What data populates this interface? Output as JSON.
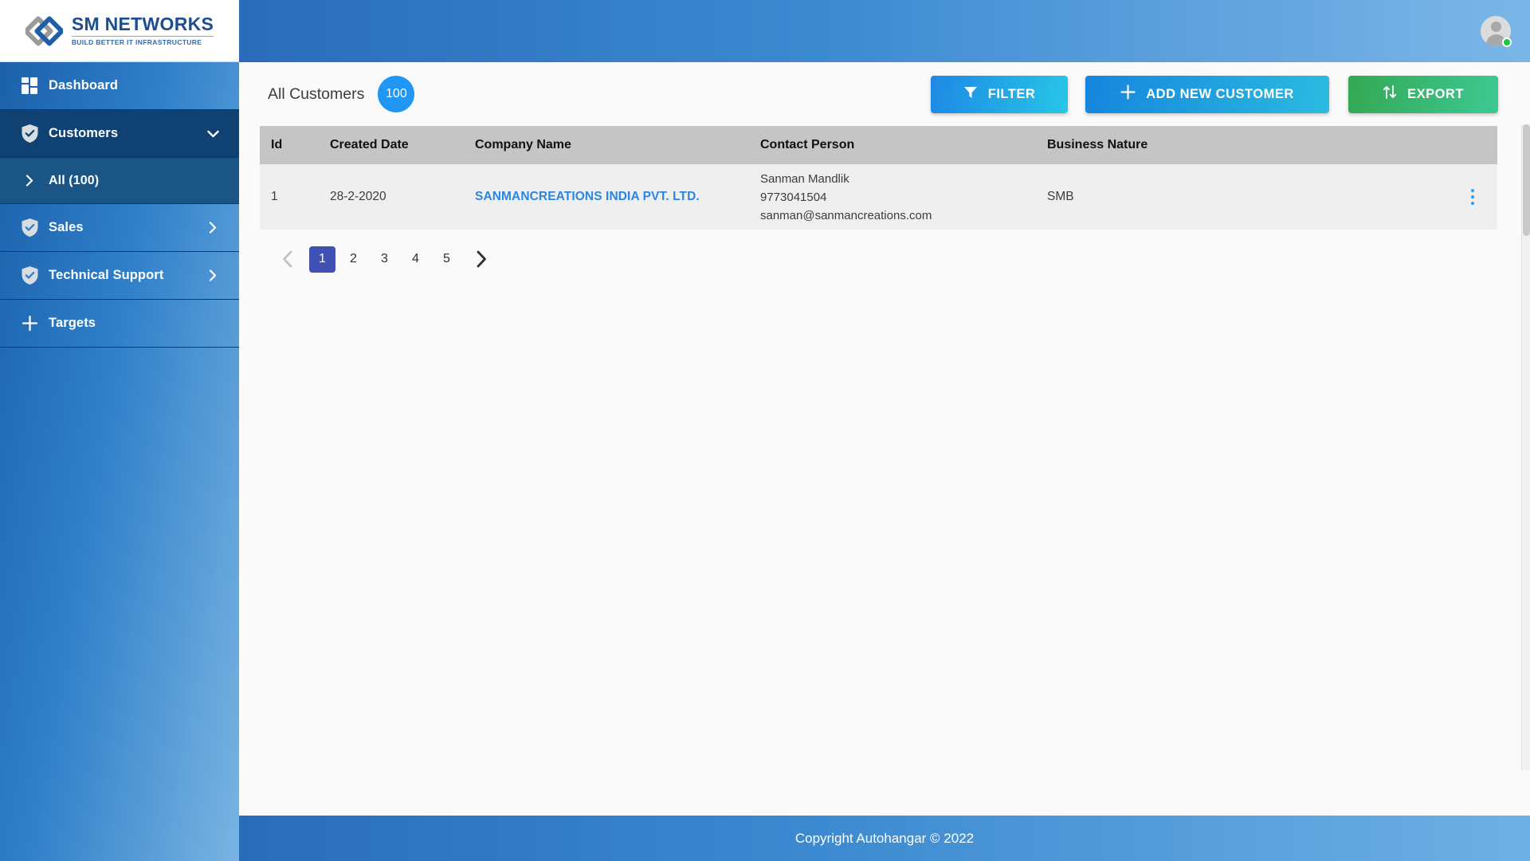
{
  "brand": {
    "name": "SM NETWORKS",
    "tagline": "BUILD BETTER IT INFRASTRUCTURE",
    "logo_icon": "interlocking-squares-logo",
    "color_primary": "#1d4e8f",
    "color_accent": "#2d6bb5"
  },
  "sidebar": {
    "items": [
      {
        "label": "Dashboard",
        "icon": "grid-dashboard-icon",
        "chevron": "",
        "state": "default"
      },
      {
        "label": "Customers",
        "icon": "shield-check-icon",
        "chevron": "down",
        "state": "active"
      },
      {
        "label": "All (100)",
        "icon": "chevron-right-icon",
        "chevron": "",
        "state": "sub-active"
      },
      {
        "label": "Sales",
        "icon": "shield-check-icon",
        "chevron": "right",
        "state": "default"
      },
      {
        "label": "Technical Support",
        "icon": "shield-check-icon",
        "chevron": "right",
        "state": "default"
      },
      {
        "label": "Targets",
        "icon": "plus-icon",
        "chevron": "",
        "state": "default"
      }
    ]
  },
  "topbar": {
    "avatar_icon": "user-avatar-icon",
    "status": "online",
    "status_color": "#12cc3d"
  },
  "main": {
    "page_title": "All Customers",
    "count_badge": "100",
    "badge_color": "#2196f3",
    "buttons": {
      "filter": {
        "label": "FILTER",
        "icon": "funnel-icon"
      },
      "add": {
        "label": "ADD NEW CUSTOMER",
        "icon": "plus-icon"
      },
      "export": {
        "label": "EXPORT",
        "icon": "sort-updown-arrows-icon"
      }
    },
    "table": {
      "columns": [
        "Id",
        "Created Date",
        "Company Name",
        "Contact Person",
        "Business Nature"
      ],
      "rows": [
        {
          "id": "1",
          "created_date": "28-2-2020",
          "company_name": "SANMANCREATIONS INDIA PVT. LTD.",
          "contact_name": "Sanman Mandlik",
          "contact_phone": "9773041504",
          "contact_email": "sanman@sanmancreations.com",
          "business_nature": "SMB",
          "row_menu_icon": "kebab-menu-icon"
        }
      ]
    },
    "pagination": {
      "prev_icon": "chevron-left-icon",
      "next_icon": "chevron-right-icon",
      "pages": [
        "1",
        "2",
        "3",
        "4",
        "5"
      ],
      "active_page": "1",
      "active_color": "#3f51b5"
    }
  },
  "footer": {
    "text": "Copyright Autohangar © 2022"
  }
}
